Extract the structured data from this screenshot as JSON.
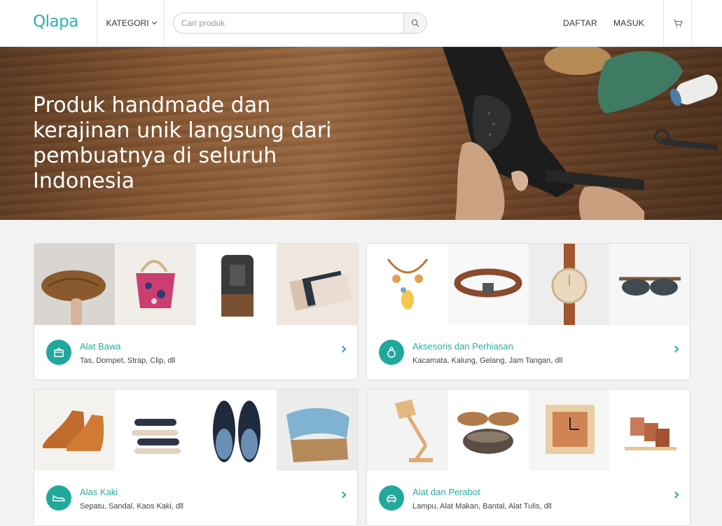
{
  "header": {
    "logo": "Qlapa",
    "kategori_label": "KATEGORI",
    "search": {
      "placeholder": "Cari produk"
    },
    "daftar_label": "DAFTAR",
    "masuk_label": "MASUK"
  },
  "hero": {
    "title": "Produk handmade dan kerajinan unik langsung dari pembuatnya di seluruh Indonesia"
  },
  "categories": [
    {
      "title": "Alat Bawa",
      "subtitle": "Tas, Dompet, Strap, Clip, dll",
      "icon": "bag-icon"
    },
    {
      "title": "Aksesoris dan Perhiasan",
      "subtitle": "Kacamata, Kalung, Gelang, Jam Tangan, dll",
      "icon": "ring-icon"
    },
    {
      "title": "Alas Kaki",
      "subtitle": "Sepatu, Sandal, Kaos Kaki, dll",
      "icon": "shoe-icon"
    },
    {
      "title": "Alat dan Perabot",
      "subtitle": "Lampu, Alat Makan, Bantal, Alat Tulis, dll",
      "icon": "chair-icon"
    }
  ],
  "colors": {
    "brand": "#2bb3a8",
    "icon_bg": "#20a89c"
  }
}
